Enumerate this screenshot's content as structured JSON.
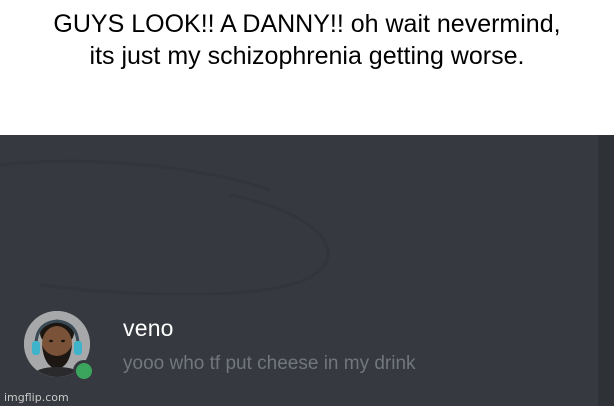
{
  "meme": {
    "caption_line1": "GUYS LOOK!! A DANNY!! oh wait nevermind,",
    "caption_line2": "its just my schizophrenia getting worse."
  },
  "chat": {
    "message": {
      "username": "veno",
      "text": "yooo who tf put cheese in my drink",
      "avatar_icon": "user-avatar-icon",
      "status": "online",
      "status_color": "#3ba55d"
    },
    "background_color": "#36393f"
  },
  "watermark": {
    "text": "imgflip.com"
  }
}
